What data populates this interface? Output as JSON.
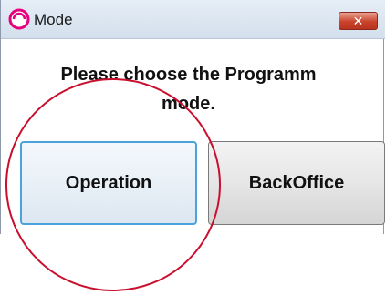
{
  "window": {
    "title": "Mode",
    "close_label": "✕"
  },
  "dialog": {
    "message_line1": "Please choose the Programm",
    "message_line2": "mode."
  },
  "buttons": {
    "operation_label": "Operation",
    "backoffice_label": "BackOffice"
  },
  "colors": {
    "highlight_circle": "#c8102e",
    "focus_border": "#4aa3dc",
    "close_button": "#c9432c"
  },
  "icons": {
    "app": "app-logo-icon",
    "close": "close-icon"
  }
}
